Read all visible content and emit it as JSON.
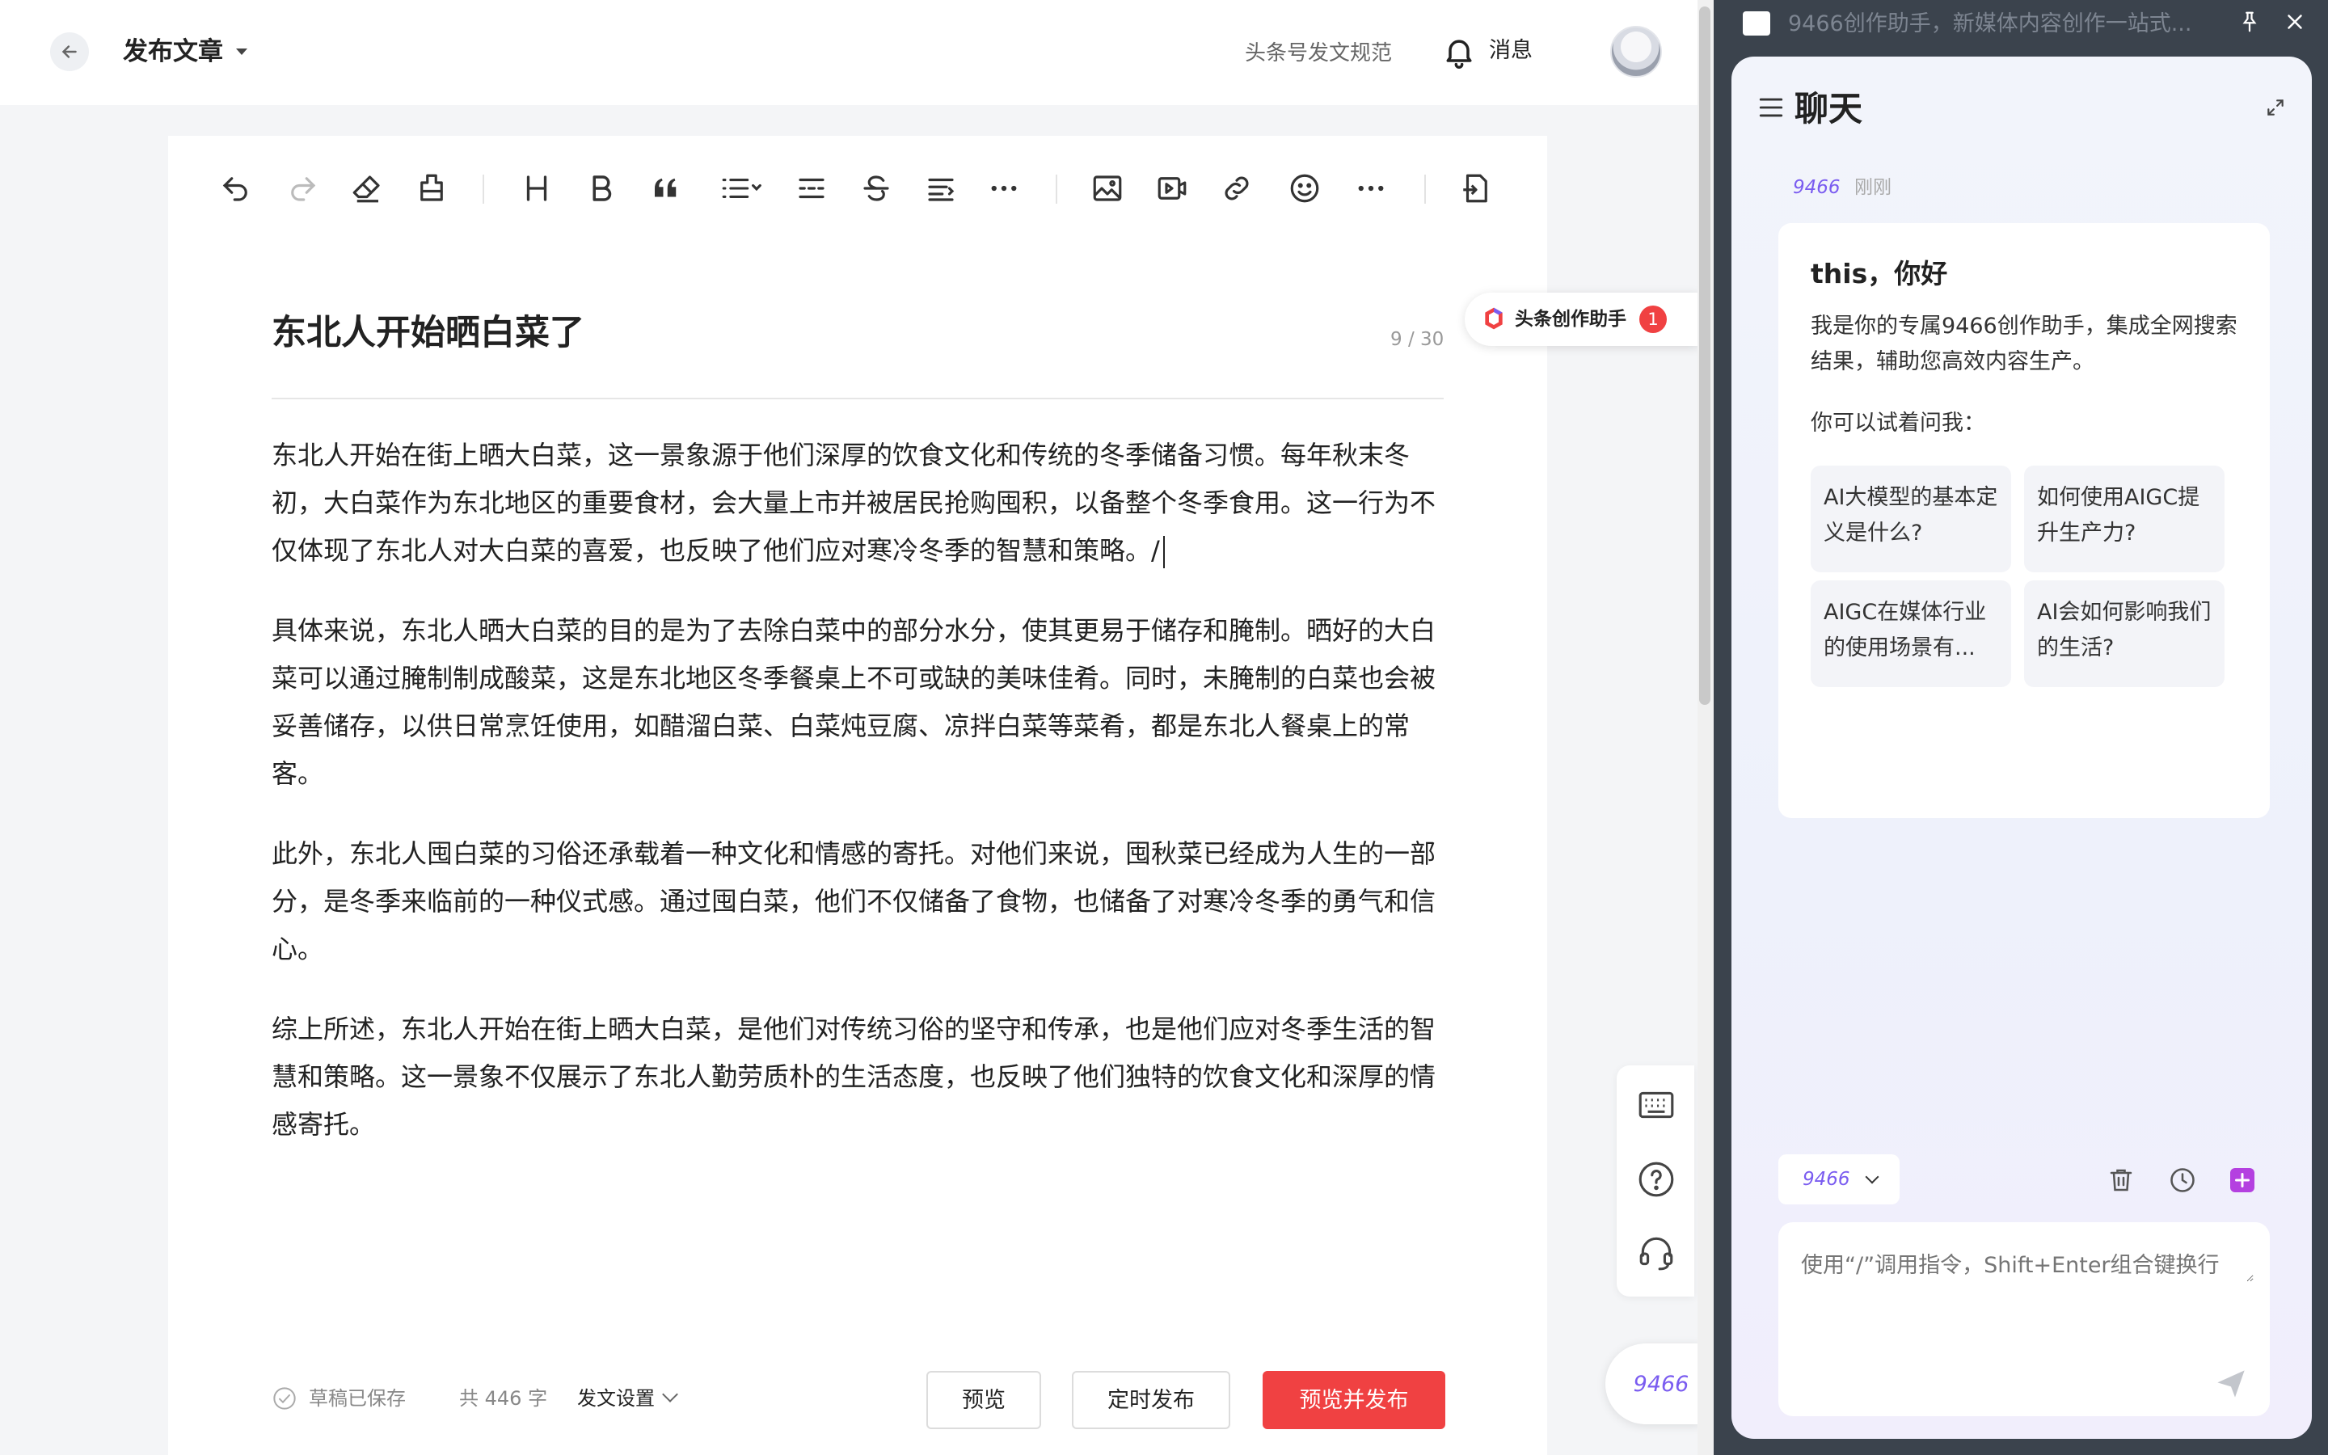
{
  "topbar": {
    "page_title": "发布文章",
    "rules_link": "头条号发文规范",
    "messages": "消息"
  },
  "toolbar": {
    "icons": [
      "undo-icon",
      "redo-icon",
      "eraser-icon",
      "format-brush-icon",
      "heading-icon",
      "bold-icon",
      "quote-icon",
      "list-icon",
      "divider-icon",
      "strikethrough-icon",
      "indent-icon",
      "more-icon",
      "image-icon",
      "video-icon",
      "link-icon",
      "emoji-icon",
      "more-insert-icon",
      "import-doc-icon"
    ]
  },
  "article": {
    "title": "东北人开始晒白菜了",
    "title_counter": "9 / 30",
    "paragraphs": [
      "东北人开始在街上晒大白菜，这一景象源于他们深厚的饮食文化和传统的冬季储备习惯。每年秋末冬初，大白菜作为东北地区的重要食材，会大量上市并被居民抢购囤积，以备整个冬季食用。这一行为不仅体现了东北人对大白菜的喜爱，也反映了他们应对寒冷冬季的智慧和策略。/",
      "具体来说，东北人晒大白菜的目的是为了去除白菜中的部分水分，使其更易于储存和腌制。晒好的大白菜可以通过腌制制成酸菜，这是东北地区冬季餐桌上不可或缺的美味佳肴。同时，未腌制的白菜也会被妥善储存，以供日常烹饪使用，如醋溜白菜、白菜炖豆腐、凉拌白菜等菜肴，都是东北人餐桌上的常客。",
      "此外，东北人囤白菜的习俗还承载着一种文化和情感的寄托。对他们来说，囤秋菜已经成为人生的一部分，是冬季来临前的一种仪式感。通过囤白菜，他们不仅储备了食物，也储备了对寒冷冬季的勇气和信心。",
      "综上所述，东北人开始在街上晒大白菜，是他们对传统习俗的坚守和传承，也是他们应对冬季生活的智慧和策略。这一景象不仅展示了东北人勤劳质朴的生活态度，也反映了他们独特的饮食文化和深厚的情感寄托。"
    ]
  },
  "assistant_tab": {
    "label": "头条创作助手",
    "badge": "1"
  },
  "float_button": "9466",
  "bottom": {
    "saved": "草稿已保存",
    "word_count": "共 446 字",
    "settings": "发文设置",
    "preview": "预览",
    "schedule": "定时发布",
    "publish": "预览并发布"
  },
  "side_window": {
    "title": "9466创作助手，新媒体内容创作一站式...",
    "chat_title": "聊天",
    "sender": "9466",
    "sender_time": "刚刚",
    "greeting": "this，你好",
    "intro": "我是你的专属9466创作助手，集成全网搜索结果，辅助您高效内容生产。",
    "try_label": "你可以试着问我：",
    "suggestions": [
      "AI大模型的基本定义是什么?",
      "如何使用AIGC提升生产力?",
      "AIGC在媒体行业的使用场景有...",
      "AI会如何影响我们的生活?"
    ],
    "model": "9466",
    "input_placeholder": "使用“/”调用指令，Shift+Enter组合键换行"
  },
  "colors": {
    "publish_red": "#f04142",
    "brand_purple": "#7a5cf0",
    "side_dark": "#3b434d"
  }
}
